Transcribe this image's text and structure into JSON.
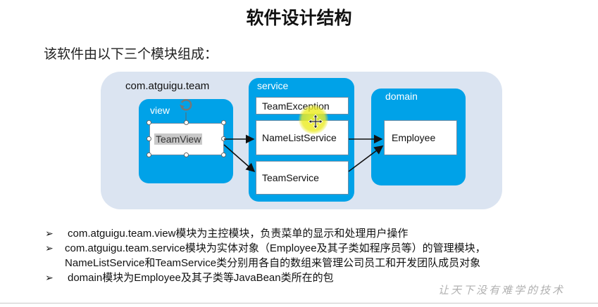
{
  "title": "软件设计结构",
  "subtitle": "该软件由以下三个模块组成：",
  "diagram": {
    "package_label": "com.atguigu.team",
    "modules": {
      "view": {
        "label": "view",
        "classes": [
          "TeamView"
        ]
      },
      "service": {
        "label": "service",
        "classes": [
          "TeamException",
          "NameListService",
          "TeamService"
        ]
      },
      "domain": {
        "label": "domain",
        "classes": [
          "Employee"
        ]
      }
    },
    "colors": {
      "package_bg": "#dbe4f1",
      "module": "#00a2e8",
      "box_border": "#6a8ea8",
      "cursor_highlight": "#f0f028"
    }
  },
  "bullets": [
    {
      "mark": "➢",
      "text": "com.atguigu.team.view模块为主控模块，负责菜单的显示和处理用户操作"
    },
    {
      "mark": "➢",
      "text": "com.atguigu.team.service模块为实体对象（Employee及其子类如程序员等）的管理模块，",
      "continuation": "NameListService和TeamService类分别用各自的数组来管理公司员工和开发团队成员对象"
    },
    {
      "mark": "➢",
      "text": "domain模块为Employee及其子类等JavaBean类所在的包"
    }
  ],
  "watermark": "让天下没有难学的技术"
}
